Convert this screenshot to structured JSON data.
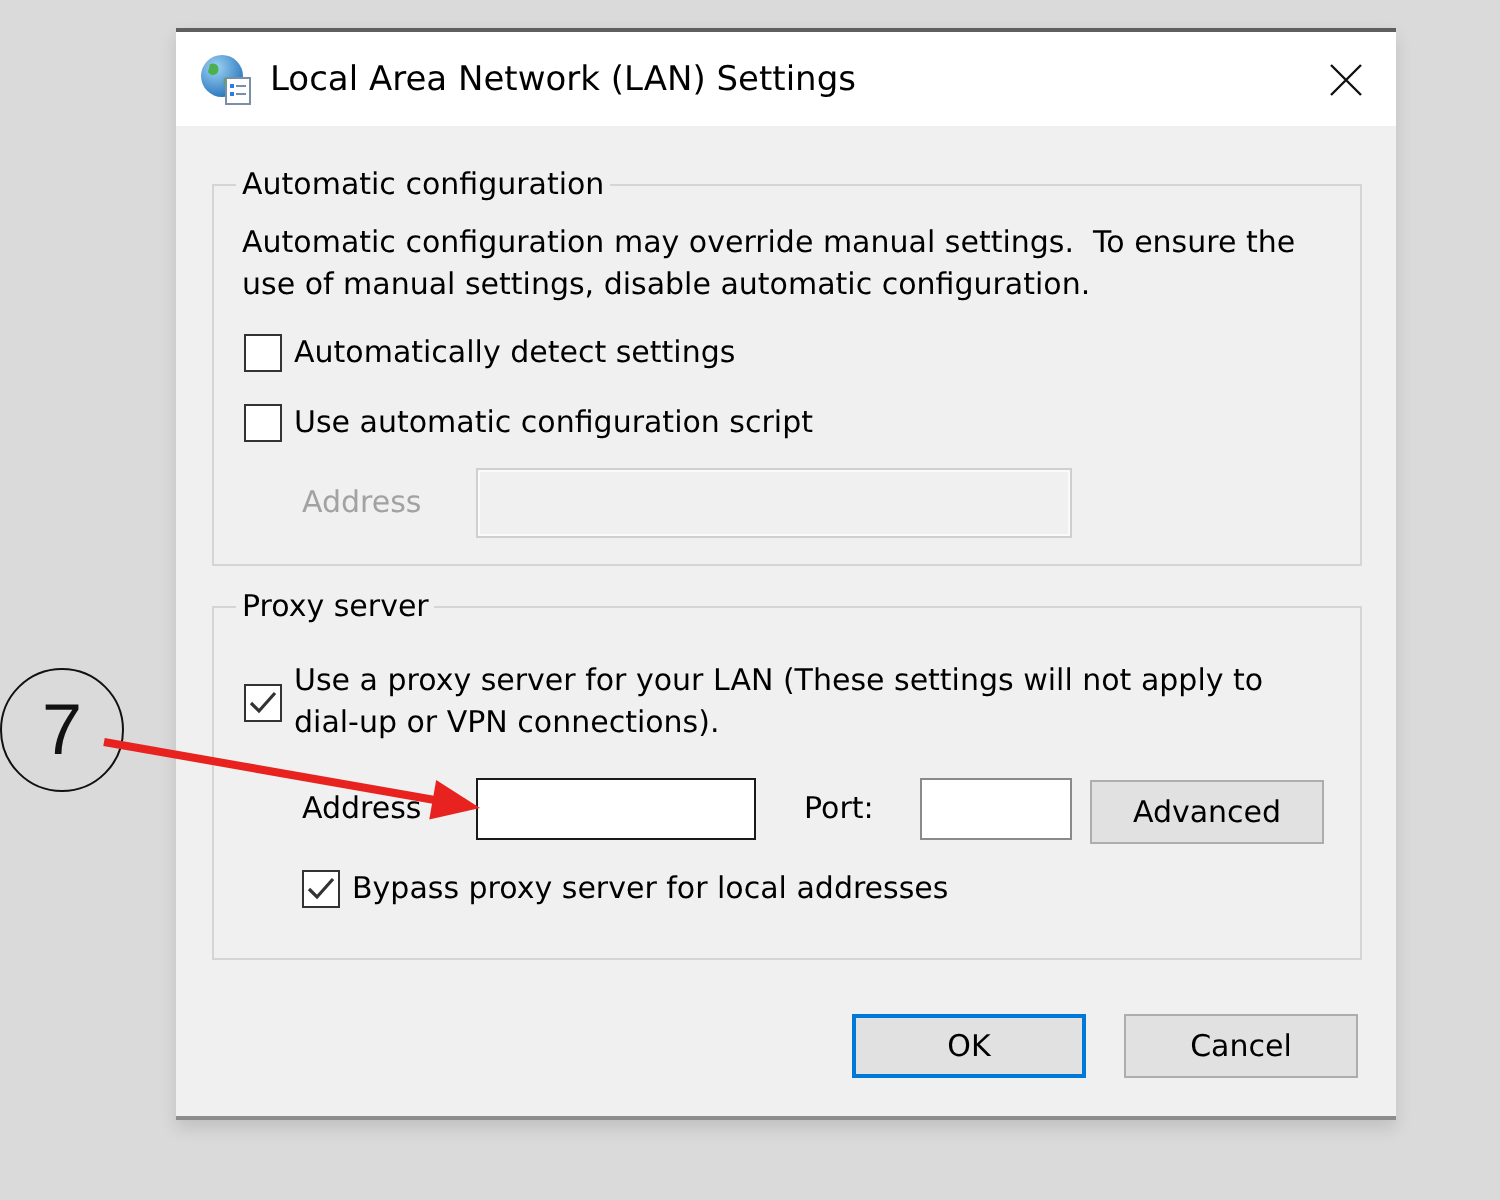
{
  "window": {
    "title": "Local Area Network (LAN) Settings"
  },
  "automatic_configuration": {
    "title": "Automatic configuration",
    "description": "Automatic configuration may override manual settings.  To ensure the use of manual settings, disable automatic configuration.",
    "options": [
      {
        "label": "Automatically detect settings",
        "checked": false
      },
      {
        "label": "Use automatic configuration script",
        "checked": false
      }
    ],
    "address": {
      "label": "Address",
      "disabled": true
    }
  },
  "proxy_server": {
    "title": "Proxy server",
    "use_proxy": {
      "label": "Use a proxy server for your LAN (These settings will not apply to dial-up or VPN connections).",
      "checked": true
    },
    "address": {
      "label": "Address",
      "disabled": false,
      "focused": true
    },
    "port": {
      "label": "Port:"
    },
    "advanced_button": {
      "label": "Advanced"
    },
    "bypass_local": {
      "label": "Bypass proxy server for local addresses",
      "checked": true
    }
  },
  "buttons": [
    {
      "label": "OK",
      "default": true
    },
    {
      "label": "Cancel",
      "default": false
    }
  ],
  "annotation": {
    "number": "7"
  }
}
